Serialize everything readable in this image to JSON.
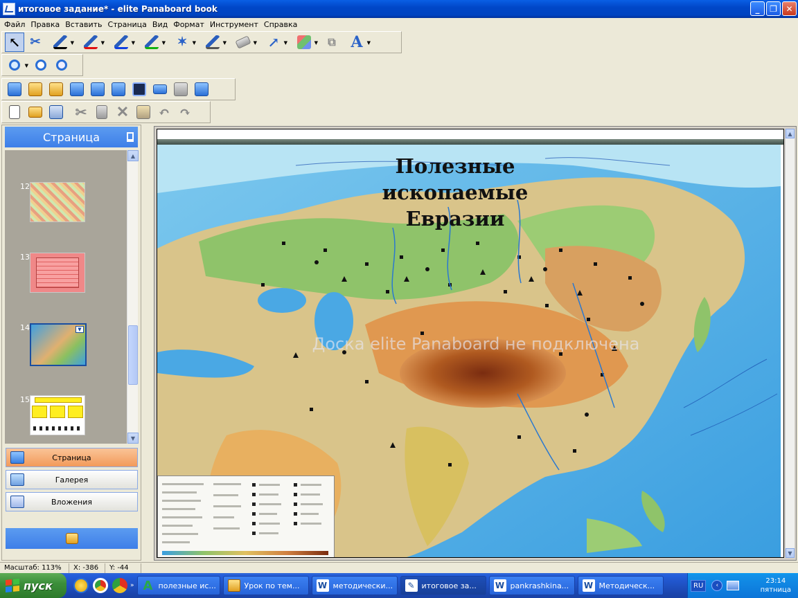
{
  "window": {
    "title": "итоговое задание* - elite Panaboard book",
    "controls": [
      "minimize",
      "restore",
      "close"
    ]
  },
  "menu": [
    "Файл",
    "Правка",
    "Вставить",
    "Страница",
    "Вид",
    "Формат",
    "Инструмент",
    "Справка"
  ],
  "toolbar_draw": [
    {
      "name": "select-tool-icon"
    },
    {
      "name": "scissors-select-icon"
    },
    {
      "name": "pen-black-icon"
    },
    {
      "name": "pen-red-icon"
    },
    {
      "name": "pen-blue-icon"
    },
    {
      "name": "pen-green-icon"
    },
    {
      "name": "highlighter-icon"
    },
    {
      "name": "pen-gray-icon"
    },
    {
      "name": "eraser-icon"
    },
    {
      "name": "line-tool-icon"
    },
    {
      "name": "shape-tool-icon"
    },
    {
      "name": "group-icon"
    },
    {
      "name": "text-tool-icon"
    }
  ],
  "toolbar_zoom": [
    {
      "name": "zoom-icon"
    },
    {
      "name": "zoom-in-icon"
    },
    {
      "name": "zoom-out-icon"
    }
  ],
  "toolbar_page": [
    {
      "name": "add-page-icon"
    },
    {
      "name": "prev-page-icon"
    },
    {
      "name": "next-page-icon"
    },
    {
      "name": "camera-icon"
    },
    {
      "name": "capture-screen-icon"
    },
    {
      "name": "capture-window-icon"
    },
    {
      "name": "screen-icon"
    },
    {
      "name": "keyboard-icon"
    },
    {
      "name": "stamp-icon"
    },
    {
      "name": "fullscreen-icon"
    }
  ],
  "toolbar_file": [
    {
      "name": "new-file-icon"
    },
    {
      "name": "open-file-icon"
    },
    {
      "name": "save-icon"
    },
    {
      "name": "cut-icon"
    },
    {
      "name": "copy-icon"
    },
    {
      "name": "delete-icon"
    },
    {
      "name": "paste-icon"
    },
    {
      "name": "undo-icon"
    },
    {
      "name": "redo-icon"
    }
  ],
  "left_panel": {
    "title": "Страница",
    "thumbnails": [
      {
        "number": "12"
      },
      {
        "number": "13"
      },
      {
        "number": "14"
      },
      {
        "number": "15"
      }
    ],
    "tabs": [
      {
        "label": "Страница",
        "active": true
      },
      {
        "label": "Галерея",
        "active": false
      },
      {
        "label": "Вложения",
        "active": false
      }
    ]
  },
  "canvas": {
    "map_title_line1": "Полезные ископаемые",
    "map_title_line2": "Евразии",
    "watermark": "Доска elite Panaboard не подключена"
  },
  "status": {
    "zoom": "Масштаб: 113%",
    "x": "X: -386",
    "y": "Y: -44"
  },
  "taskbar": {
    "start": "пуск",
    "tasks": [
      {
        "label": "полезные ис...",
        "icon_color": "#2aa84a",
        "glyph": "A"
      },
      {
        "label": "Урок по тем...",
        "icon_color": "#f0c040",
        "glyph": ""
      },
      {
        "label": "методически...",
        "icon_color": "#ffffff",
        "glyph": "W"
      },
      {
        "label": "итоговое за...",
        "icon_color": "#ffffff",
        "glyph": "✎"
      },
      {
        "label": "pankrashkina...",
        "icon_color": "#ffffff",
        "glyph": "W"
      },
      {
        "label": "Методическ...",
        "icon_color": "#ffffff",
        "glyph": "W"
      }
    ],
    "lang": "RU",
    "time": "23:14",
    "day": "пятница"
  },
  "colors": {
    "title_blue": "#0047c8",
    "active_tab_orange": "#f29a5a",
    "panel_header_blue": "#3e7fe8"
  }
}
